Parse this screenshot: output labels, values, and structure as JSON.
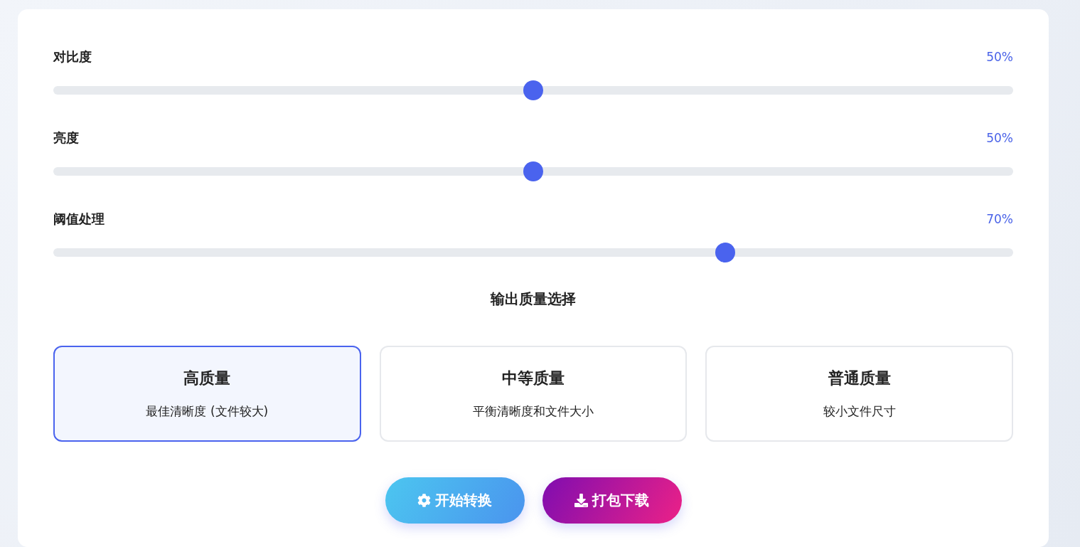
{
  "sliders": [
    {
      "label": "对比度",
      "reading": "50%",
      "level": 0.5
    },
    {
      "label": "亮度",
      "reading": "50%",
      "level": 0.5
    },
    {
      "label": "阈值处理",
      "reading": "70%",
      "level": 0.7
    }
  ],
  "quality": {
    "title": "输出质量选择",
    "options": [
      {
        "name": "高质量",
        "description": "最佳清晰度 (文件较大)",
        "selected": true
      },
      {
        "name": "中等质量",
        "description": "平衡清晰度和文件大小",
        "selected": false
      },
      {
        "name": "普通质量",
        "description": "较小文件尺寸",
        "selected": false
      }
    ]
  },
  "buttons": [
    {
      "kind": "convert",
      "label": "开始转换"
    },
    {
      "kind": "download",
      "label": "打包下载"
    }
  ]
}
